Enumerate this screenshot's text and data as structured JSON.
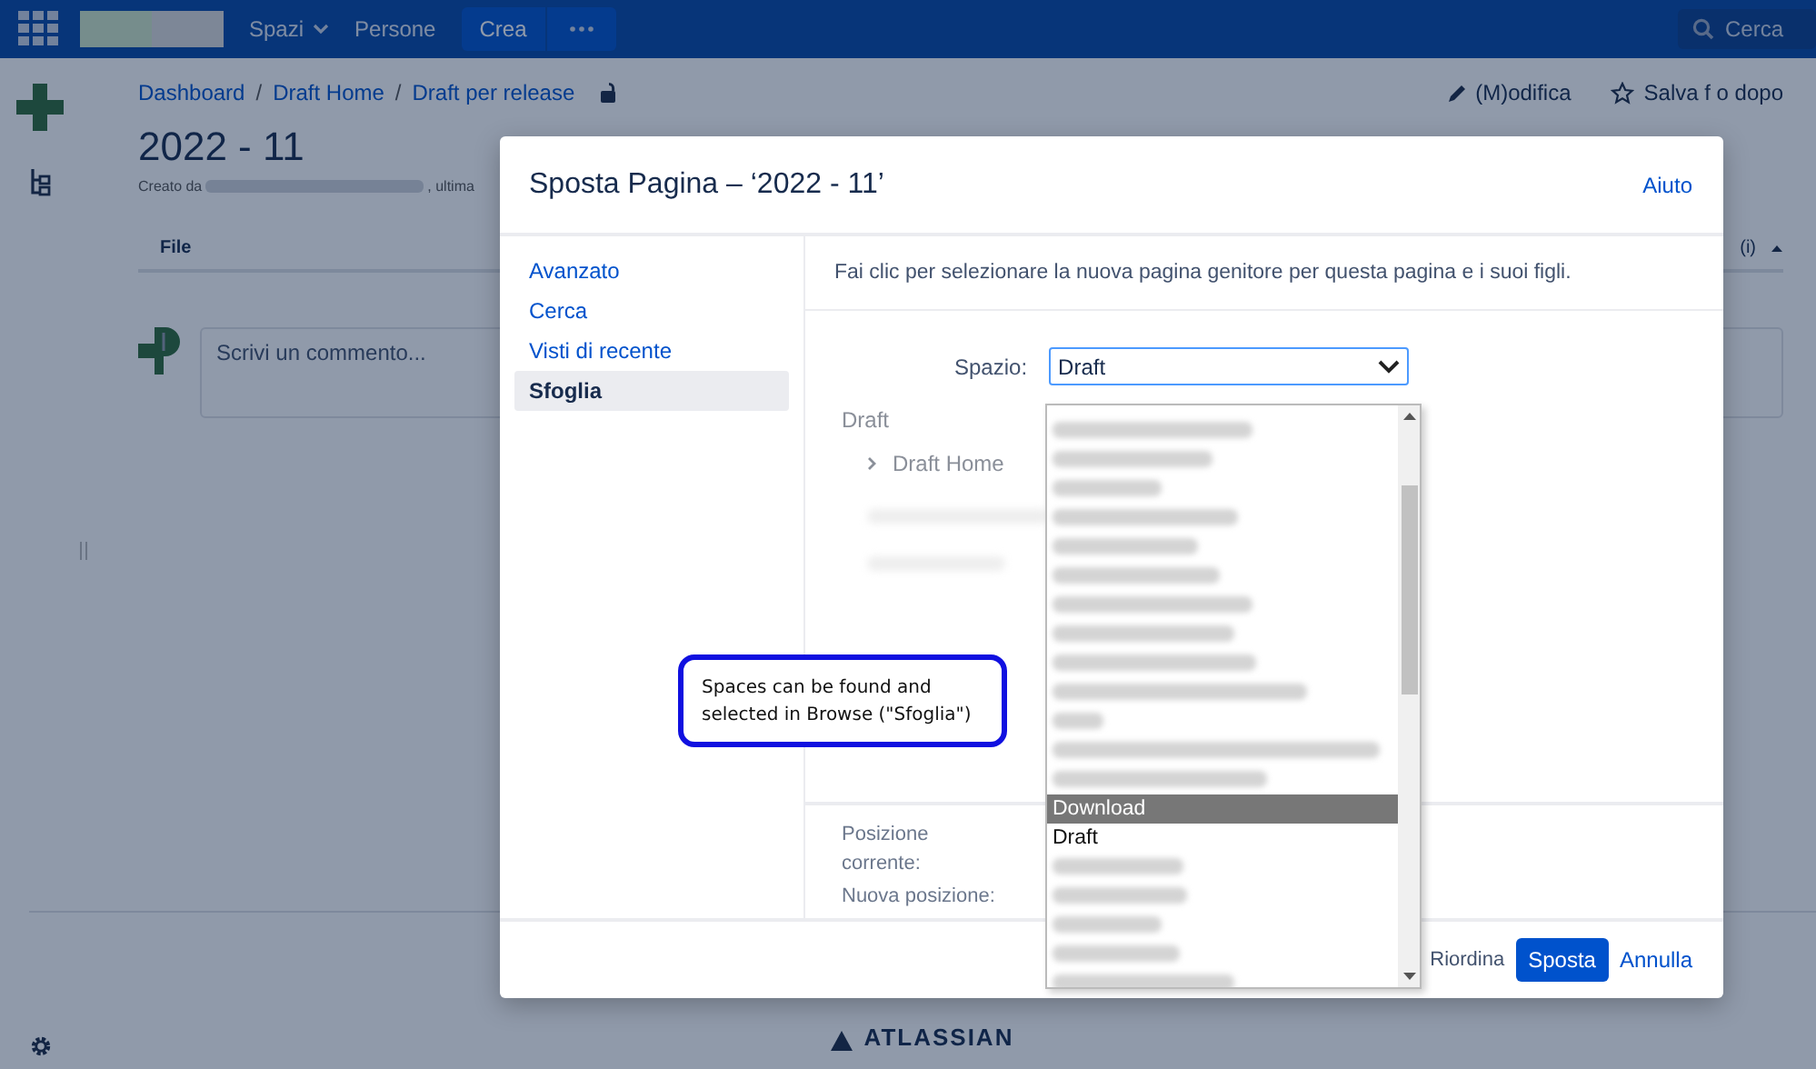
{
  "top_nav": {
    "spaces_menu": "Spazi",
    "people_link": "Persone",
    "create_button": "Crea",
    "search": {
      "placeholder": "Cerca"
    }
  },
  "page": {
    "breadcrumbs": [
      "Dashboard",
      "Draft Home",
      "Draft per release"
    ],
    "breadcrumb_separator": "/",
    "actions": [
      {
        "kind": "edit",
        "label": "(M)odifica"
      },
      {
        "kind": "save",
        "label": "Salva f o dopo"
      }
    ],
    "title": "2022 - 11",
    "byline_start": "Creato da",
    "byline_end": ", ultima",
    "table": {
      "columns": [
        "File",
        "(i)"
      ]
    },
    "comment": {
      "placeholder": "Scrivi un commento..."
    },
    "footer_brand": "ATLASSIAN"
  },
  "dialog": {
    "title": "Sposta Pagina – ‘2022 - 11’",
    "help_link": "Aiuto",
    "nav_items": [
      {
        "label": "Avanzato",
        "selected": false
      },
      {
        "label": "Cerca",
        "selected": false
      },
      {
        "label": "Visti di recente",
        "selected": false
      },
      {
        "label": "Sfoglia",
        "selected": true
      }
    ],
    "description": "Fai clic per selezionare la nuova pagina genitore per questa pagina e i suoi figli.",
    "space_label": "Spazio:",
    "space_value": "Draft",
    "tree": {
      "label": "Draft",
      "children": [
        {
          "label": "Draft Home",
          "expanded": false
        }
      ]
    },
    "current_position_label": "Posizione corrente:",
    "new_position_label": "Nuova posizione:",
    "reorder_label": "Riordina",
    "move_button": "Sposta",
    "cancel_link": "Annulla",
    "space_options": [
      {
        "label": "Download",
        "selected": true
      },
      {
        "label": "Draft",
        "selected": false
      }
    ]
  },
  "callout": {
    "text": "Spaces can be found and selected in Browse (\"Sfoglia\")"
  }
}
